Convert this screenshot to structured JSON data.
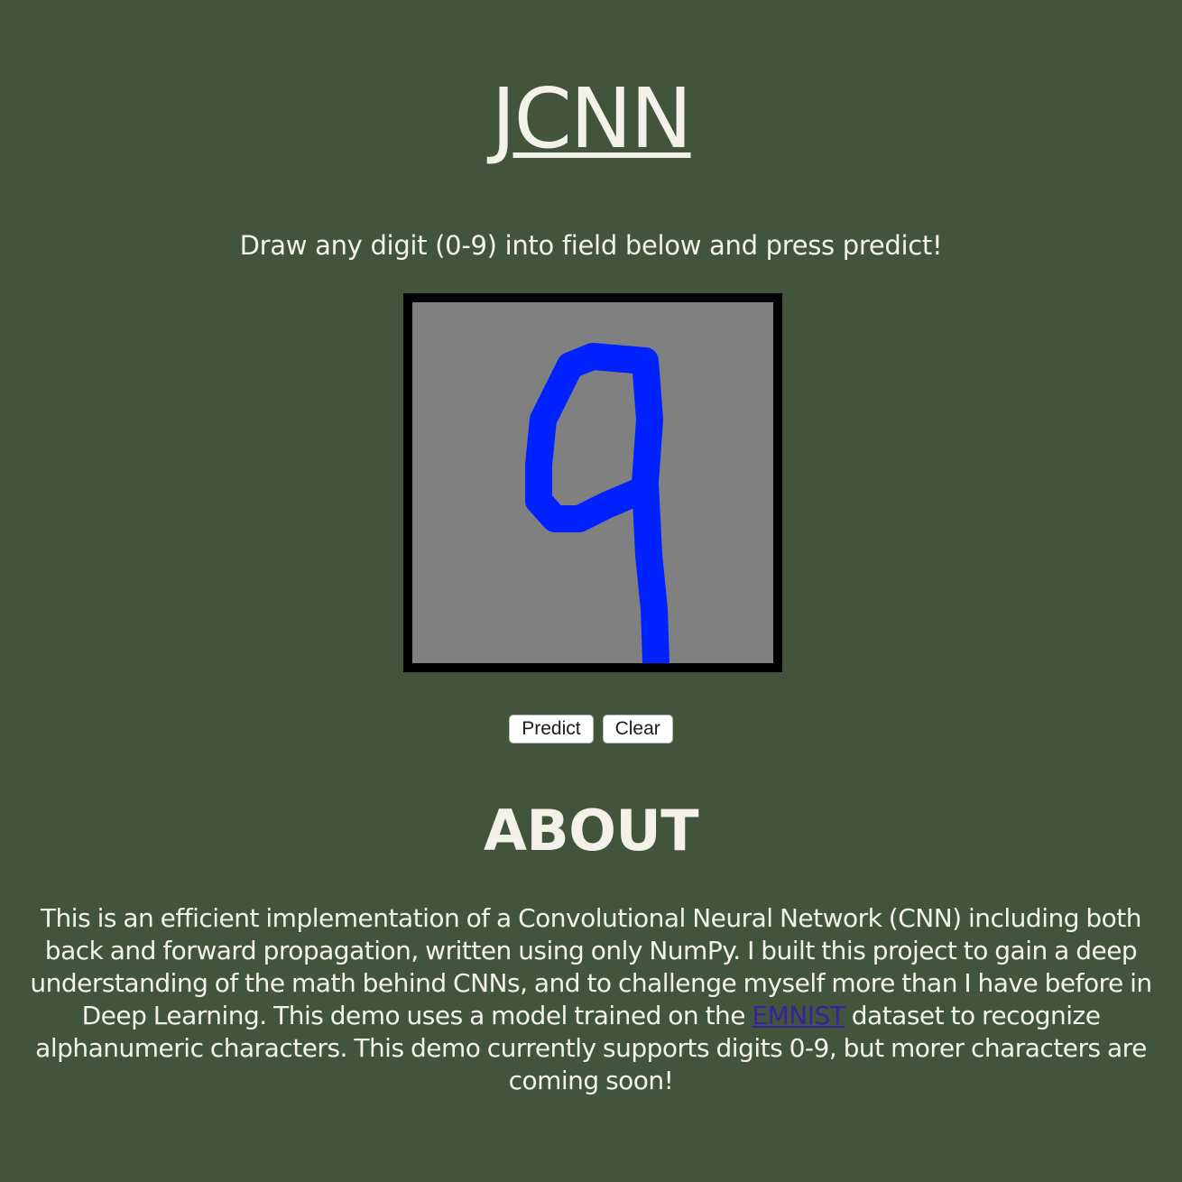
{
  "header": {
    "title": "JCNN"
  },
  "instructions": "Draw any digit (0-9) into field below and press predict!",
  "drawing": {
    "canvas_color": "#808080",
    "border_color": "#000000",
    "stroke_color": "#0022ff",
    "drawn_content": "handwritten digit 9"
  },
  "buttons": {
    "predict_label": "Predict",
    "clear_label": "Clear"
  },
  "about": {
    "heading": "ABOUT",
    "text_before_link": "This is an efficient implementation of a Convolutional Neural Network (CNN) including both back and forward propagation, written using only NumPy. I built this project to gain a deep understanding of the math behind CNNs, and to challenge myself more than I have before in Deep Learning. This demo uses a model trained on the ",
    "link_text": "EMNIST",
    "text_after_link": " dataset to recognize alphanumeric characters. This demo currently supports digits 0-9, but morer characters are coming soon!"
  },
  "colors": {
    "background": "#42553a",
    "text": "#f3f1ea",
    "link": "#3b1fa3"
  }
}
